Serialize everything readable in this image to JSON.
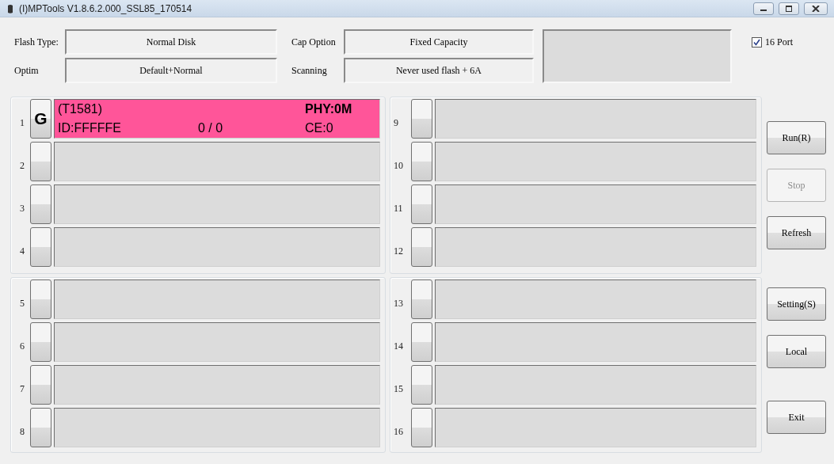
{
  "window": {
    "title": "(I)MPTools V1.8.6.2.000_SSL85_170514"
  },
  "settings": [
    {
      "label": "Flash Type:",
      "value": "Normal Disk"
    },
    {
      "label": "Cap Option",
      "value": "Fixed Capacity"
    },
    {
      "label": "Optim",
      "value": "Default+Normal"
    },
    {
      "label": "Scanning",
      "value": "Never used flash + 6A"
    }
  ],
  "port_option": {
    "label": "16 Port",
    "checked": true
  },
  "groups": [
    {
      "ports": [
        {
          "number": "1",
          "button_label": "G",
          "active": true,
          "chip": "(T1581)",
          "phy": "PHY:0M",
          "id": "ID:FFFFFE",
          "count": "0 / 0",
          "ce": "CE:0"
        },
        {
          "number": "2",
          "active": false
        },
        {
          "number": "3",
          "active": false
        },
        {
          "number": "4",
          "active": false
        }
      ]
    },
    {
      "ports": [
        {
          "number": "9",
          "active": false
        },
        {
          "number": "10",
          "active": false
        },
        {
          "number": "11",
          "active": false
        },
        {
          "number": "12",
          "active": false
        }
      ]
    },
    {
      "ports": [
        {
          "number": "5",
          "active": false
        },
        {
          "number": "6",
          "active": false
        },
        {
          "number": "7",
          "active": false
        },
        {
          "number": "8",
          "active": false
        }
      ]
    },
    {
      "ports": [
        {
          "number": "13",
          "active": false
        },
        {
          "number": "14",
          "active": false
        },
        {
          "number": "15",
          "active": false
        },
        {
          "number": "16",
          "active": false
        }
      ]
    }
  ],
  "buttons": [
    {
      "label": "Run(R)",
      "disabled": false
    },
    {
      "label": "Stop",
      "disabled": true
    },
    {
      "label": "Refresh",
      "disabled": false
    },
    {
      "label": "Setting(S)",
      "disabled": false
    },
    {
      "label": "Local",
      "disabled": false
    },
    {
      "label": "Exit",
      "disabled": false
    }
  ]
}
